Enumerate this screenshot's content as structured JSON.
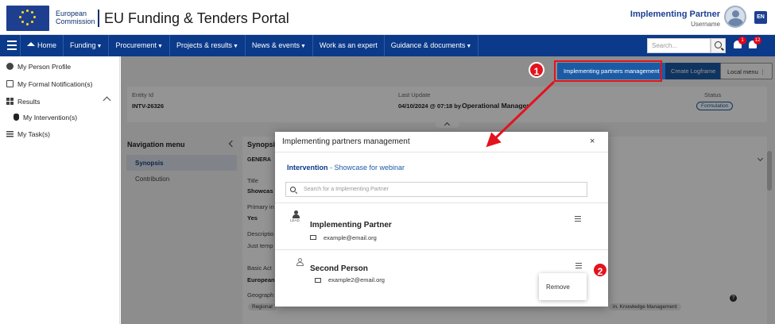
{
  "header": {
    "ec_line1": "European",
    "ec_line2": "Commission",
    "portal_title": "EU Funding & Tenders Portal",
    "user_name": "Implementing Partner",
    "user_sub": "Username",
    "lang": "EN",
    "notif_badge_1": "1",
    "notif_badge_2": "12"
  },
  "nav": {
    "home": "Home",
    "funding": "Funding",
    "procurement": "Procurement",
    "projects": "Projects & results",
    "news": "News & events",
    "expert": "Work as an expert",
    "guidance": "Guidance & documents",
    "search_placeholder": "Search..."
  },
  "sidebar": {
    "items": [
      {
        "label": "My Person Profile"
      },
      {
        "label": "My Formal Notification(s)"
      },
      {
        "label": "Results"
      },
      {
        "label": "My Intervention(s)"
      },
      {
        "label": "My Task(s)"
      }
    ]
  },
  "toolbar": {
    "ipm": "Implementing partners management",
    "logframe": "Create Logframe",
    "local_menu": "Local menu ⋮"
  },
  "entity": {
    "id_label": "Entity Id",
    "id_value": "INTV-26326",
    "update_label": "Last Update",
    "update_value": "04/10/2024 @ 07:18 by",
    "update_by": "Operational Manager",
    "status_label": "Status",
    "status_value": "Formulation"
  },
  "navmenu": {
    "title": "Navigation menu",
    "synopsis": "Synopsis",
    "contribution": "Contribution"
  },
  "content": {
    "heading": "Synopsi",
    "section": "GENERA",
    "title_label": "Title",
    "title_value": "Showcas",
    "primary_label": "Primary in",
    "primary_value": "Yes",
    "desc_label": "Descriptio",
    "desc_value": "Just temp",
    "basic_act_label": "Basic Act",
    "basic_act_value": "European",
    "geo_label": "Geograph",
    "tag1": "Regional",
    "tag2": "in. Knowledge Management"
  },
  "modal": {
    "title": "Implementing partners management",
    "close": "×",
    "intervention_prefix": "Intervention",
    "intervention_name": " - Showcase for webinar",
    "search_placeholder": "Search for a Implementing Partner",
    "partners": [
      {
        "name": "Implementing Partner",
        "email": "example@email.org",
        "lead": "LEAD"
      },
      {
        "name": "Second Person",
        "email": "example2@email.org"
      }
    ],
    "dropdown_remove": "Remove"
  },
  "callouts": {
    "one": "1",
    "two": "2"
  },
  "colors": {
    "nav_bg": "#0b3a8a",
    "accent": "#1b5ba6",
    "callout": "#e3131d"
  }
}
